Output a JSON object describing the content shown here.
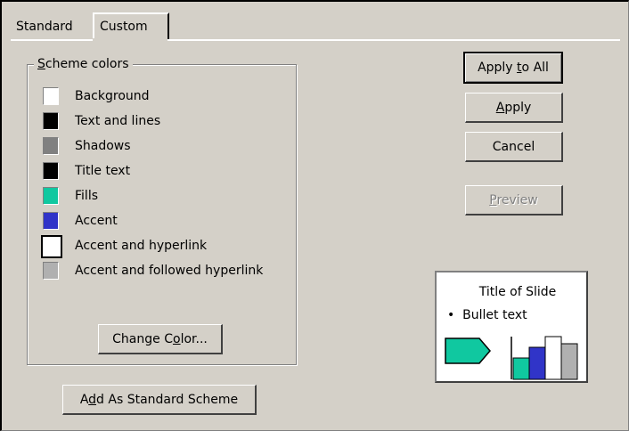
{
  "tabs": [
    {
      "label": "Standard",
      "active": false
    },
    {
      "label": "Custom",
      "active": true
    }
  ],
  "scheme": {
    "legend_prefix": "",
    "legend_mnemonic": "S",
    "legend_rest": "cheme colors",
    "colors": [
      {
        "label": "Background",
        "color": "#ffffff"
      },
      {
        "label": "Text and lines",
        "color": "#000000"
      },
      {
        "label": "Shadows",
        "color": "#808080"
      },
      {
        "label": "Title text",
        "color": "#000000"
      },
      {
        "label": "Fills",
        "color": "#10c8a0"
      },
      {
        "label": "Accent",
        "color": "#3034c8"
      },
      {
        "label": "Accent and hyperlink",
        "color": "#ffffff",
        "selected": true
      },
      {
        "label": "Accent and followed hyperlink",
        "color": "#b0b0b0"
      }
    ],
    "change_color": {
      "prefix": "Change C",
      "mnemonic": "o",
      "rest": "lor..."
    }
  },
  "add_standard": {
    "prefix": "A",
    "mnemonic": "d",
    "rest": "d As Standard Scheme"
  },
  "buttons": {
    "apply_to_all": {
      "prefix": "Apply ",
      "mnemonic": "t",
      "rest": "o All"
    },
    "apply": {
      "prefix": "",
      "mnemonic": "A",
      "rest": "pply"
    },
    "cancel": {
      "label": "Cancel"
    },
    "preview": {
      "prefix": "",
      "mnemonic": "P",
      "rest": "review",
      "disabled": true
    }
  },
  "preview_panel": {
    "title": "Title of Slide",
    "bullet": "Bullet text",
    "colors": {
      "arrow_fill": "#10c8a0",
      "bar1": "#10c8a0",
      "bar2": "#3034c8",
      "bar3": "#ffffff",
      "bar4": "#b0b0b0"
    }
  }
}
